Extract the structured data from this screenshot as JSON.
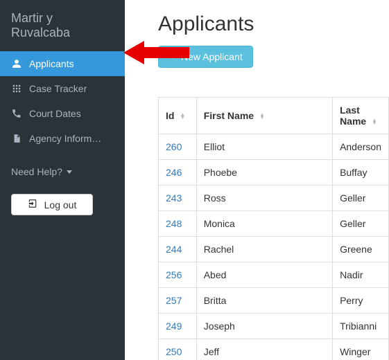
{
  "brand": "Martir y Ruvalcaba",
  "sidebar": {
    "items": [
      {
        "label": "Applicants",
        "icon": "user-icon",
        "active": true
      },
      {
        "label": "Case Tracker",
        "icon": "grid-icon",
        "active": false
      },
      {
        "label": "Court Dates",
        "icon": "phone-icon",
        "active": false
      },
      {
        "label": "Agency Inform…",
        "icon": "file-icon",
        "active": false
      }
    ],
    "need_help_label": "Need Help?",
    "logout_label": "Log out"
  },
  "page": {
    "title": "Applicants",
    "new_button_label": "New Applicant"
  },
  "table": {
    "columns": {
      "id": "Id",
      "first_name": "First Name",
      "last_name": "Last Name"
    },
    "rows": [
      {
        "id": "260",
        "first_name": "Elliot",
        "last_name": "Anderson"
      },
      {
        "id": "246",
        "first_name": "Phoebe",
        "last_name": "Buffay"
      },
      {
        "id": "243",
        "first_name": "Ross",
        "last_name": "Geller"
      },
      {
        "id": "248",
        "first_name": "Monica",
        "last_name": "Geller"
      },
      {
        "id": "244",
        "first_name": "Rachel",
        "last_name": "Greene"
      },
      {
        "id": "256",
        "first_name": "Abed",
        "last_name": "Nadir"
      },
      {
        "id": "257",
        "first_name": "Britta",
        "last_name": "Perry"
      },
      {
        "id": "249",
        "first_name": "Joseph",
        "last_name": "Tribianni"
      },
      {
        "id": "250",
        "first_name": "Jeff",
        "last_name": "Winger"
      }
    ]
  },
  "annotation": {
    "arrow_color": "#e60000"
  }
}
